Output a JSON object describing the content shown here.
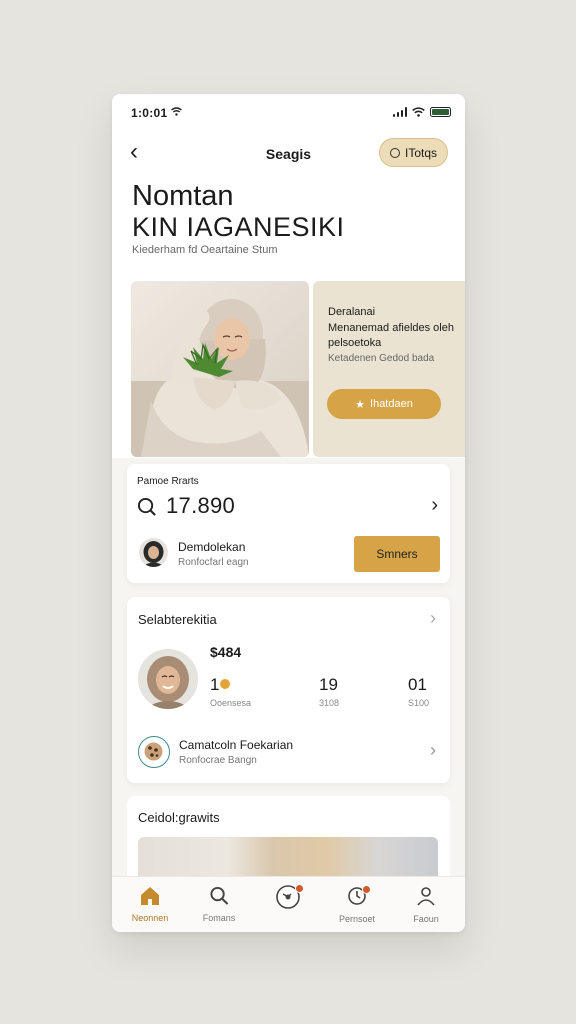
{
  "status": {
    "time": "1:0:01"
  },
  "nav": {
    "title": "Seagis",
    "action_label": "ITotqs"
  },
  "hero": {
    "title_line1": "Nomtan",
    "title_line2": "KIN IAGANESIKI",
    "subtitle": "Kiederham fd Oeartaine Stum"
  },
  "promo": {
    "line1": "Deralanai",
    "line2": "Menanemad afieldes oleh pelsoetoka",
    "line3": "Ketadenen Gedod bada",
    "button_label": "Ihatdaen"
  },
  "balance_card": {
    "label": "Pamoe Rrarts",
    "value": "17.890",
    "row_name": "Demdolekan",
    "row_sub": "Ronfocfarl eagn",
    "button_label": "Smners"
  },
  "activity_card": {
    "title": "Selabterekitia",
    "amount": "$484",
    "stats": [
      {
        "value": "1",
        "label": "Ooensesa"
      },
      {
        "value": "19",
        "label": "3108"
      },
      {
        "value": "01",
        "label": "S100"
      }
    ],
    "row_name": "Camatcoln Foekarian",
    "row_sub": "Ronfocrae Bangn"
  },
  "gallery_card": {
    "title": "Ceidol:grawits"
  },
  "tabbar": {
    "items": [
      {
        "label": "Neonnen",
        "icon": "home-icon"
      },
      {
        "label": "Fomans",
        "icon": "search-icon"
      },
      {
        "label": "",
        "icon": "compass-icon"
      },
      {
        "label": "Pernsoet",
        "icon": "clock-icon"
      },
      {
        "label": "Faoun",
        "icon": "profile-icon"
      }
    ]
  },
  "colors": {
    "accent": "#d6a447",
    "accent_light": "#ecdcb8",
    "background": "#e6e4de"
  }
}
